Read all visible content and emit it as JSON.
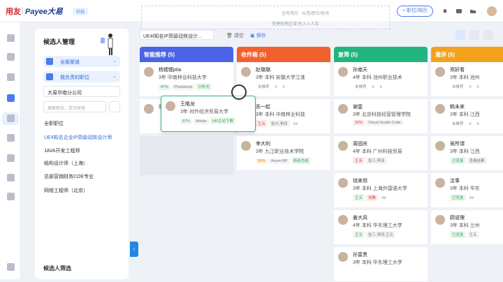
{
  "topbar": {
    "logo_primary": "用友",
    "logo_secondary": "Payee大易",
    "chip": "社招",
    "ghost_search": "全有简历   ·   标签/职位/姓名",
    "ghost_hint": "快捷拖拽区域 拖入入人库",
    "add_button": "+ 职位/简历"
  },
  "sidebar": {
    "title": "候选人管理",
    "channel_label": "全部渠道",
    "my_jobs_label": "我负责的职位",
    "company": "大易华南分公司",
    "search_placeholder": "搜索职位、支持拼音",
    "jobs": [
      "全职职位",
      "UE4知名企业IP高级动效设计师",
      "JAVA开发工程师",
      "结构设计师（上海）",
      "总部营销财务COE专业",
      "网络工程师（北京）"
    ],
    "footer_title": "候选人筛选"
  },
  "tabbar": {
    "current_job": "UE4I知名IP高级动效设计...",
    "clear": "清空",
    "save": "保存"
  },
  "columns": [
    {
      "title": "智能推荐 (5)",
      "color": "#4b63e6"
    },
    {
      "title": "收件箱 (5)",
      "color": "#f2602e"
    },
    {
      "title": "复筛 (5)",
      "color": "#21b47f"
    },
    {
      "title": "邀评 (5)",
      "color": "#f3a21b"
    }
  ],
  "cards": {
    "col0": [
      {
        "name": "杨锶锶pita",
        "info": "3年  中南林业科技大学",
        "tags": [
          {
            "t": "87%",
            "c": "green"
          },
          {
            "t": "Photoshop",
            "c": ""
          },
          {
            "t": "分析式",
            "c": "green"
          }
        ]
      },
      {
        "name": "张",
        "info": "",
        "tags": []
      }
    ],
    "col1": [
      {
        "name": "赵璐璐",
        "info": "3年  本科  安徽大学江淮",
        "tags": [
          {
            "t": "未推荐",
            "c": "plain"
          },
          {
            "t": "0",
            "c": "plain"
          },
          {
            "t": "5",
            "c": "plain"
          }
        ]
      },
      {
        "name": "苏一起",
        "info": "3年  本科  中南林业科技",
        "tags": [
          {
            "t": "王五",
            "c": "red"
          },
          {
            "t": "张大,李四",
            "c": ""
          },
          {
            "t": "2d",
            "c": "plain"
          }
        ]
      },
      {
        "name": "李大利",
        "info": "3年  九江职业技术学院",
        "tags": [
          {
            "t": "96%",
            "c": "orange"
          },
          {
            "t": "Axure RP",
            "c": ""
          },
          {
            "t": "面经总结",
            "c": "green"
          }
        ]
      }
    ],
    "col2": [
      {
        "name": "孙南天",
        "info": "4年  本科  池州职业技术",
        "tags": [
          {
            "t": "未推荐",
            "c": "plain"
          },
          {
            "t": "0",
            "c": "plain"
          },
          {
            "t": "5",
            "c": "plain"
          }
        ]
      },
      {
        "name": "谢壹",
        "info": "3年  北京科技经营管理学院",
        "tags": [
          {
            "t": "32%",
            "c": "red"
          },
          {
            "t": "Visual Studio Code",
            "c": ""
          }
        ]
      },
      {
        "name": "周固庆",
        "info": "4年  本科  广州科技贸易",
        "tags": [
          {
            "t": "王五",
            "c": "red"
          },
          {
            "t": "张三,李亚",
            "c": ""
          }
        ]
      },
      {
        "name": "钱来旭",
        "info": "3年  本科  上海外国语大学",
        "tags": [
          {
            "t": "王五",
            "c": "green"
          },
          {
            "t": "何数",
            "c": "red"
          },
          {
            "t": "2d",
            "c": "plain"
          }
        ]
      },
      {
        "name": "姜大风",
        "info": "4年  本科  华东理工大学",
        "tags": [
          {
            "t": "王五",
            "c": "green"
          },
          {
            "t": "张三,李四,王五",
            "c": ""
          }
        ]
      },
      {
        "name": "孙富贵",
        "info": "3年  本科  华东理工大学",
        "tags": []
      }
    ],
    "col3": [
      {
        "name": "郑好看",
        "info": "3年  本科  池州",
        "tags": [
          {
            "t": "未推荐",
            "c": "plain"
          },
          {
            "t": "0",
            "c": "plain"
          },
          {
            "t": "5",
            "c": "plain"
          }
        ]
      },
      {
        "name": "韩未来",
        "info": "3年  本科  江西",
        "tags": [
          {
            "t": "未推荐",
            "c": "plain"
          },
          {
            "t": "0",
            "c": "plain"
          },
          {
            "t": "5",
            "c": "plain"
          }
        ]
      },
      {
        "name": "吴所谓",
        "info": "3年  本科  江西",
        "tags": [
          {
            "t": "已答复",
            "c": "green"
          },
          {
            "t": "查看结果",
            "c": ""
          }
        ]
      },
      {
        "name": "沈事",
        "info": "3年  本科  华东",
        "tags": [
          {
            "t": "已答复",
            "c": "green"
          },
          {
            "t": "2d",
            "c": "plain"
          }
        ]
      },
      {
        "name": "顾说理",
        "info": "3年  本科  兰州",
        "tags": [
          {
            "t": "已答复",
            "c": "green"
          },
          {
            "t": "王五",
            "c": ""
          }
        ]
      }
    ]
  },
  "popover": {
    "name": "王皓龙",
    "info": "3年  对外经济贸易大学",
    "tags": [
      {
        "t": "87%",
        "c": "green"
      },
      {
        "t": "Adobe",
        "c": ""
      },
      {
        "t": "HR主动下载",
        "c": "green"
      }
    ]
  }
}
